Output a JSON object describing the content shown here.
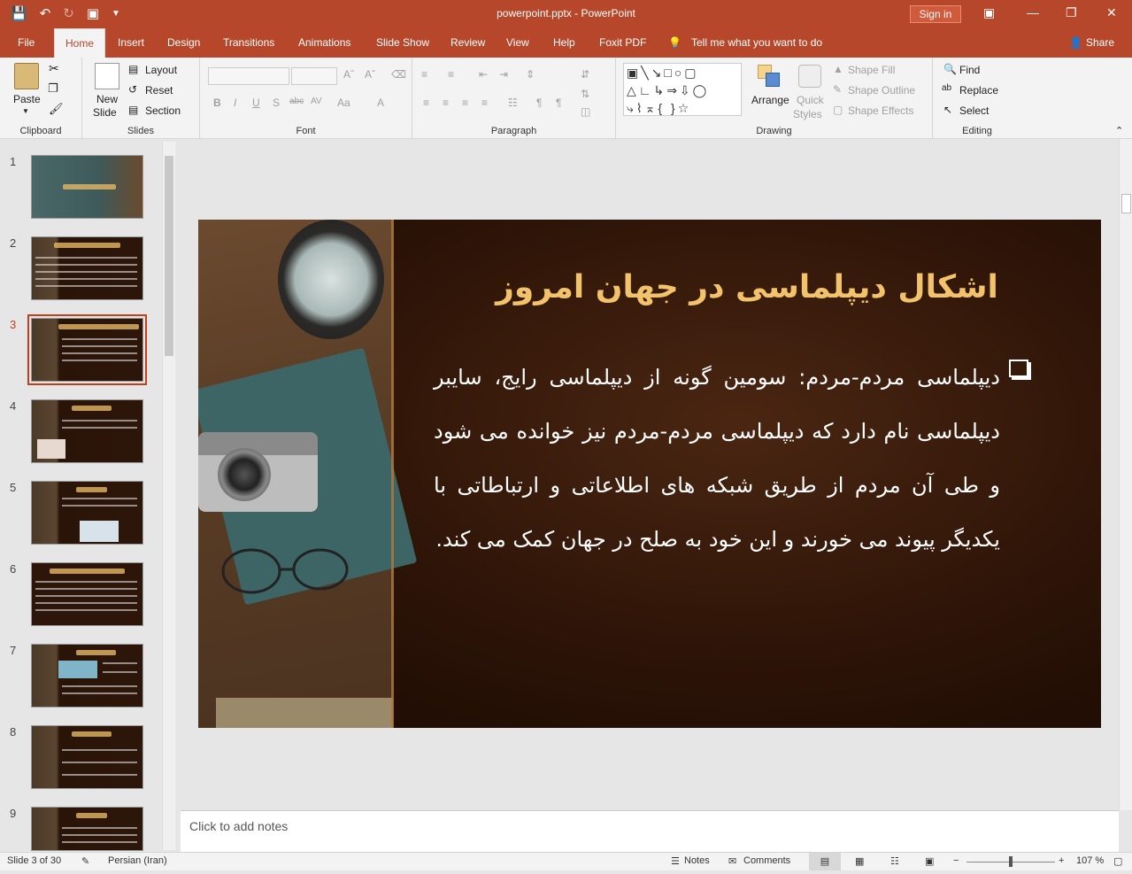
{
  "window": {
    "title": "powerpoint.pptx  -  PowerPoint",
    "signin": "Sign in"
  },
  "tabs": [
    "File",
    "Home",
    "Insert",
    "Design",
    "Transitions",
    "Animations",
    "Slide Show",
    "Review",
    "View",
    "Help",
    "Foxit PDF"
  ],
  "tell_me": "Tell me what you want to do",
  "share": "Share",
  "ribbon": {
    "clipboard": {
      "label": "Clipboard",
      "paste": "Paste"
    },
    "slides": {
      "label": "Slides",
      "new_slide_1": "New",
      "new_slide_2": "Slide",
      "layout": "Layout",
      "reset": "Reset",
      "section": "Section"
    },
    "font": {
      "label": "Font"
    },
    "paragraph": {
      "label": "Paragraph"
    },
    "drawing": {
      "label": "Drawing",
      "arrange": "Arrange",
      "quick_styles_1": "Quick",
      "quick_styles_2": "Styles",
      "shape_fill": "Shape Fill",
      "shape_outline": "Shape Outline",
      "shape_effects": "Shape Effects"
    },
    "editing": {
      "label": "Editing",
      "find": "Find",
      "replace": "Replace",
      "select": "Select"
    }
  },
  "thumbnails": [
    "1",
    "2",
    "3",
    "4",
    "5",
    "6",
    "7",
    "8",
    "9"
  ],
  "selected_slide": 3,
  "slide": {
    "title": "اشکال دیپلماسی در جهان امروز",
    "body": "دیپلماسی مردم-مردم: سومین گونه از دیپلماسی رایج، سایبر دیپلماسی نام دارد که دیپلماسی مردم-مردم نیز خوانده می شود و طی آن مردم از طریق شبکه های اطلاعاتی و ارتباطاتی با یکدیگر پیوند می خورند و این خود به صلح در جهان کمک می کند."
  },
  "notes_placeholder": "Click to add notes",
  "status": {
    "slide_info": "Slide 3 of 30",
    "language": "Persian (Iran)",
    "notes": "Notes",
    "comments": "Comments",
    "zoom": "107 %"
  },
  "colors": {
    "accent": "#b7472a",
    "title_gold": "#f3c36b"
  }
}
